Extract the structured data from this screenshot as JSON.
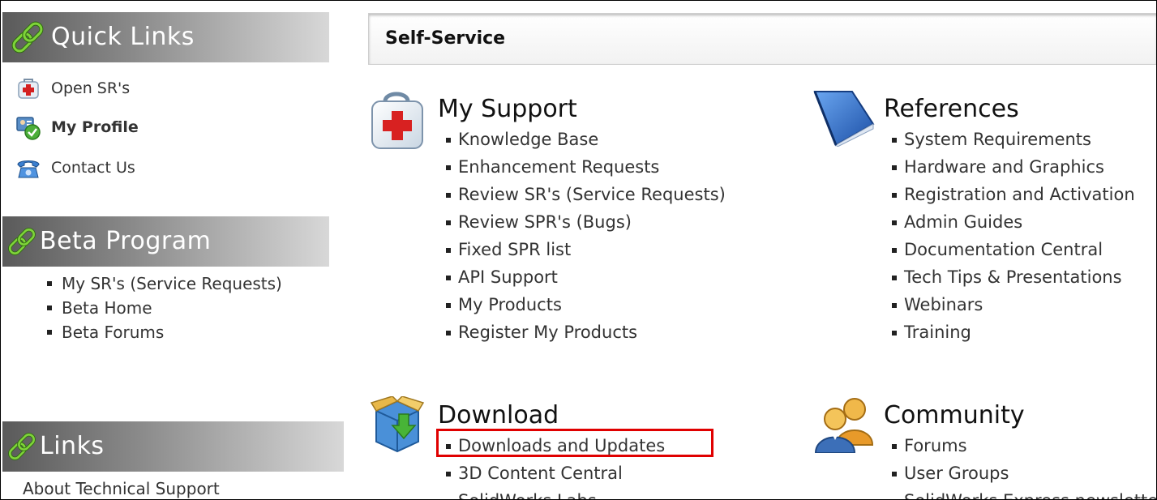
{
  "sidebar": {
    "quick_links": {
      "title": "Quick Links",
      "items": [
        {
          "label": "Open SR's",
          "icon": "first-aid-kit-icon"
        },
        {
          "label": "My Profile",
          "icon": "user-profile-icon"
        },
        {
          "label": "Contact Us",
          "icon": "telephone-icon"
        }
      ]
    },
    "beta_program": {
      "title": "Beta Program",
      "items": [
        "My SR's (Service Requests)",
        "Beta Home",
        "Beta Forums"
      ]
    },
    "links": {
      "title": "Links",
      "items": [
        "About Technical Support"
      ]
    }
  },
  "main": {
    "title": "Self-Service",
    "sections": {
      "my_support": {
        "title": "My Support",
        "icon": "first-aid-kit-icon",
        "items": [
          "Knowledge Base",
          "Enhancement Requests",
          "Review SR's (Service Requests)",
          "Review SPR's (Bugs)",
          "Fixed SPR list",
          "API Support",
          "My Products",
          "Register My Products"
        ]
      },
      "references": {
        "title": "References",
        "icon": "book-icon",
        "items": [
          "System Requirements",
          "Hardware and Graphics",
          "Registration and Activation",
          "Admin Guides",
          "Documentation Central",
          "Tech Tips & Presentations",
          "Webinars",
          "Training"
        ]
      },
      "download": {
        "title": "Download",
        "icon": "download-box-icon",
        "items": [
          "Downloads and Updates",
          "3D Content Central",
          "SolidWorks Labs"
        ]
      },
      "community": {
        "title": "Community",
        "icon": "user-group-icon",
        "items": [
          "Forums",
          "User Groups",
          "SolidWorks Express newsletter"
        ]
      }
    }
  },
  "colors": {
    "highlight": "#e00000",
    "sidebar_header_dark": "#5a5a5a",
    "link_icon_green": "#6bbf2a"
  }
}
